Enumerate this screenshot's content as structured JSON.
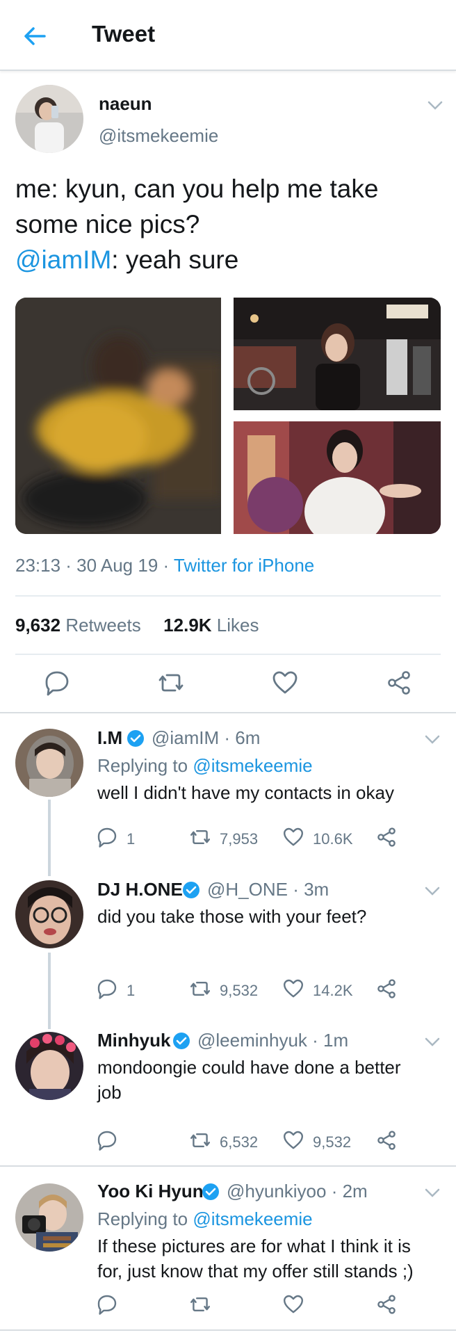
{
  "header": {
    "title": "Tweet"
  },
  "tweet": {
    "name": "naeun",
    "handle": "@itsmekeemie",
    "text_line1": "me: kyun, can you help me take",
    "text_line2": "some nice pics?",
    "mention": "@iamIM",
    "text_line3_rest": ": yeah sure",
    "time": "23:13 · 30 Aug 19 · ",
    "source": "Twitter for iPhone",
    "retweets_count": "9,632",
    "retweets_label": "Retweets",
    "likes_count": "12.9K",
    "likes_label": "Likes"
  },
  "replies": [
    {
      "name": "I.M",
      "handle_time": "@iamIM · 6m",
      "replying_prefix": "Replying to ",
      "replying_to": "@itsmekeemie",
      "text1": "well I didn't have my contacts in okay",
      "text2": "",
      "replies": "1",
      "retweets": "7,953",
      "likes": "10.6K"
    },
    {
      "name": "DJ H.ONE",
      "handle_time": "@H_ONE · 3m",
      "text1": "did you take those with your feet?",
      "text2": "",
      "replies": "1",
      "retweets": "9,532",
      "likes": "14.2K"
    },
    {
      "name": "Minhyuk",
      "handle_time": "@leeminhyuk · 1m",
      "text1": "mondoongie could have done a better",
      "text2": "job",
      "replies": "",
      "retweets": "6,532",
      "likes": "9,532"
    },
    {
      "name": "Yoo Ki Hyun",
      "handle_time": "@hyunkiyoo · 2m",
      "replying_prefix": "Replying to ",
      "replying_to": "@itsmekeemie",
      "text1": "If these pictures are for what I think it is",
      "text2": "for, just know that my offer still stands ;)",
      "replies": "",
      "retweets": "",
      "likes": ""
    }
  ],
  "colors": {
    "accent": "#1b95e0",
    "verified": "#1da1f2",
    "muted": "#657786"
  }
}
